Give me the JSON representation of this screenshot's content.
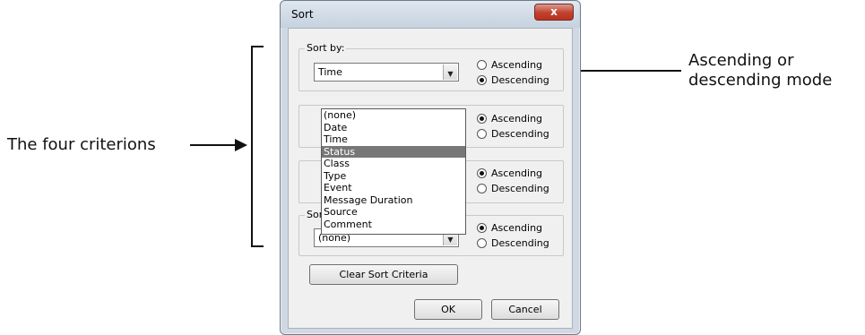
{
  "annotations": {
    "left_label": "The four criterions",
    "right_label_line1": "Ascending or",
    "right_label_line2": "descending mode"
  },
  "dialog": {
    "title": "Sort",
    "close_glyph": "x",
    "groups": [
      {
        "legend": "Sort by:",
        "combo_value": "Time",
        "radio_ascending": "Ascending",
        "radio_descending": "Descending",
        "selected": "Descending"
      },
      {
        "legend": "",
        "radio_ascending": "Ascending",
        "radio_descending": "Descending",
        "selected": "Ascending"
      },
      {
        "legend": "",
        "radio_ascending": "Ascending",
        "radio_descending": "Descending",
        "selected": "Ascending"
      },
      {
        "legend": "Sort last by:",
        "combo_value": "(none)",
        "radio_ascending": "Ascending",
        "radio_descending": "Descending",
        "selected": "Ascending"
      }
    ],
    "dropdown_items": [
      "(none)",
      "Date",
      "Time",
      "Status",
      "Class",
      "Type",
      "Event",
      "Message Duration",
      "Source",
      "Comment"
    ],
    "dropdown_highlighted": "Status",
    "combo_arrow_glyph": "▼",
    "clear_button": "Clear Sort Criteria",
    "ok_button": "OK",
    "cancel_button": "Cancel"
  }
}
